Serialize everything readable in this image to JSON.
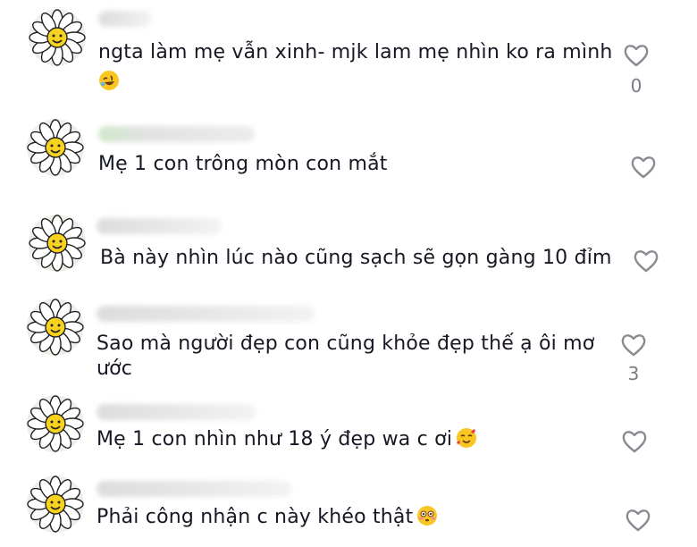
{
  "comments": [
    {
      "text_lines": [
        "ngta làm mẹ vẫn xinh- mjk lam mẹ nhìn ko ra mình"
      ],
      "trailing_emoji": "rolling-laughing-emoji",
      "emoji_on_new_line": true,
      "like_count": "0"
    },
    {
      "text_lines": [
        "Mẹ 1 con trông mòn con mắt"
      ],
      "like_count": ""
    },
    {
      "text_lines": [
        "Bà này nhìn lúc nào cũng sạch sẽ gọn gàng 10 đỉm"
      ],
      "like_count": ""
    },
    {
      "text_lines": [
        "Sao mà người đẹp con cũng khỏe đẹp thế ạ ôi mơ",
        "ước"
      ],
      "like_count": "3"
    },
    {
      "text_lines": [
        "Mẹ 1 con nhìn như 18 ý đẹp wa c ơi"
      ],
      "trailing_emoji": "smiling-hearts-emoji",
      "like_count": ""
    },
    {
      "text_lines": [
        "Phải công nhận c này khéo thật"
      ],
      "trailing_emoji": "flushed-face-emoji",
      "like_count": ""
    }
  ],
  "icons": {
    "avatar": "daisy-smiley-avatar",
    "like": "heart-outline-icon"
  },
  "colors": {
    "text": "#161823",
    "icon": "#8a8b91",
    "count": "#7a7b82",
    "daisy_center": "#f7d21e"
  }
}
